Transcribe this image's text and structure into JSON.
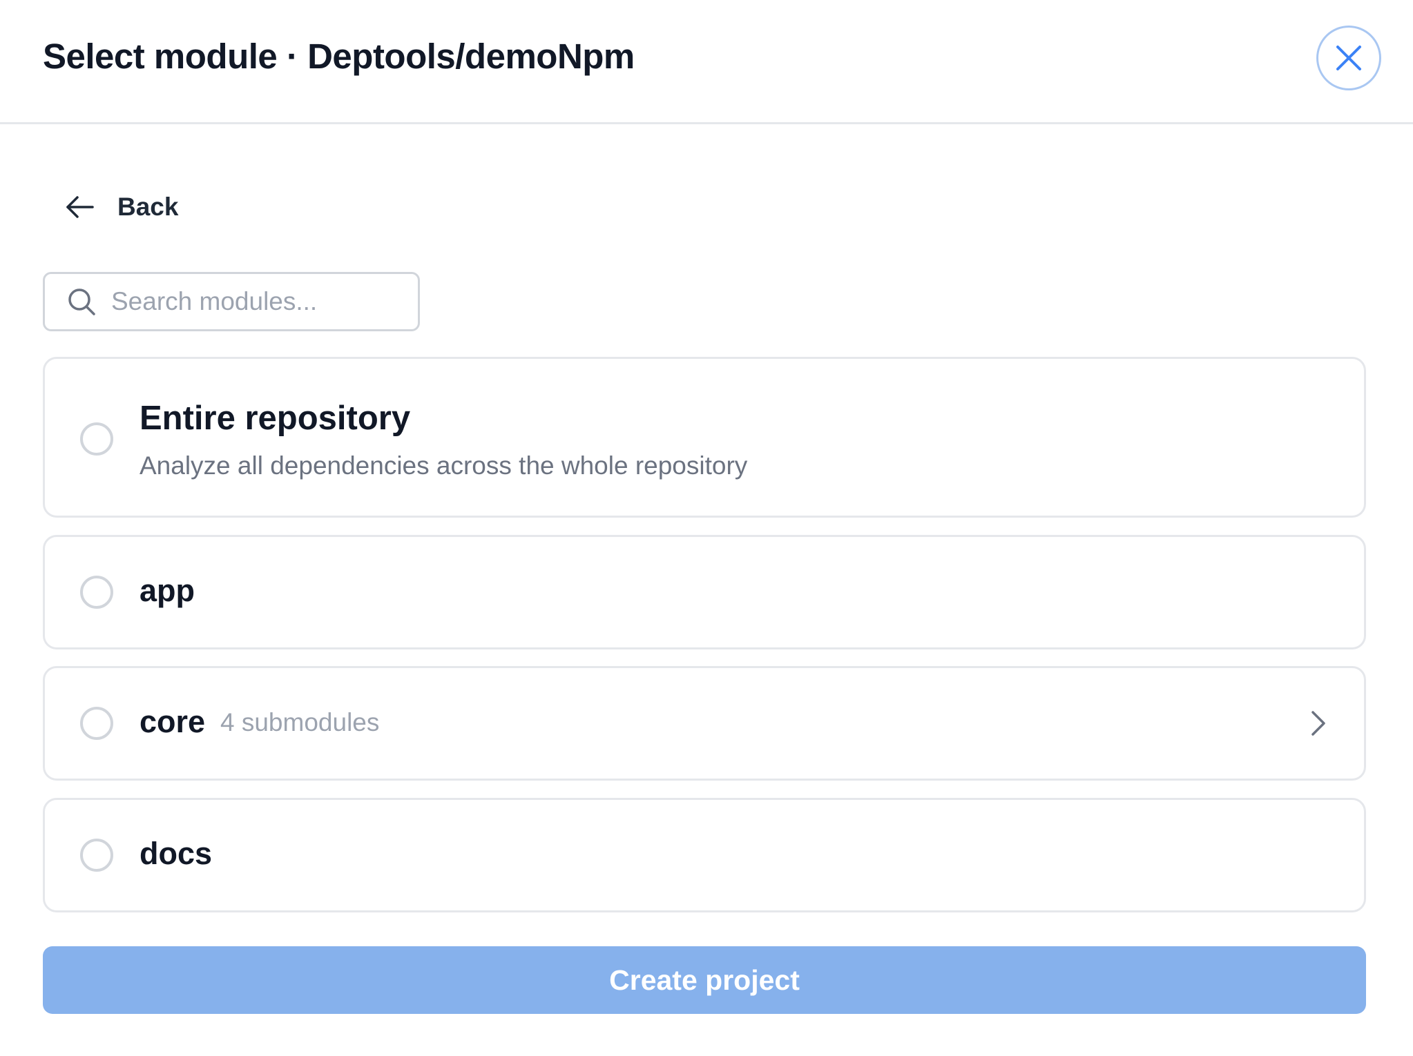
{
  "header": {
    "title": "Select module · Deptools/demoNpm",
    "close_icon": "close-icon"
  },
  "back": {
    "label": "Back",
    "icon": "arrow-left-icon"
  },
  "search": {
    "placeholder": "Search modules...",
    "value": "",
    "icon": "search-icon"
  },
  "options": [
    {
      "name": "Entire repository",
      "description": "Analyze all dependencies across the whole repository",
      "selected": false
    },
    {
      "name": "app",
      "selected": false
    },
    {
      "name": "core",
      "submodules": "4 submodules",
      "selected": false,
      "expand_icon": "chevron-right-icon"
    },
    {
      "name": "docs",
      "selected": false
    }
  ],
  "actions": {
    "create_label": "Create project",
    "create_enabled": false
  },
  "colors": {
    "primary_disabled": "#86b1ec",
    "close_border": "#a9c7f2",
    "close_icon": "#3b82f6",
    "border": "#e5e7eb",
    "muted_text": "#6b7280",
    "placeholder_text": "#9ca3af"
  }
}
